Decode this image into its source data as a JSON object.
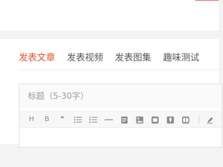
{
  "tabs": [
    {
      "label": "发表文章",
      "active": true
    },
    {
      "label": "发表视频",
      "active": false
    },
    {
      "label": "发表图集",
      "active": false
    },
    {
      "label": "趣味测试",
      "active": false
    }
  ],
  "editor": {
    "title_placeholder": "标题（5-30字）",
    "toolbar": {
      "heading_label": "H",
      "bold_label": "B",
      "quote_label": "❝",
      "icons": [
        "heading-icon",
        "bold-icon",
        "quote-icon",
        "bullet-list-icon",
        "numbered-list-icon",
        "divider-icon",
        "document-icon",
        "image-icon",
        "video-icon",
        "audio-icon",
        "gallery-icon",
        "pen-icon"
      ]
    }
  },
  "colors": {
    "accent": "#e8512f",
    "top_line": "#e56a6a",
    "text": "#555555",
    "icon": "#8a8a8a"
  }
}
